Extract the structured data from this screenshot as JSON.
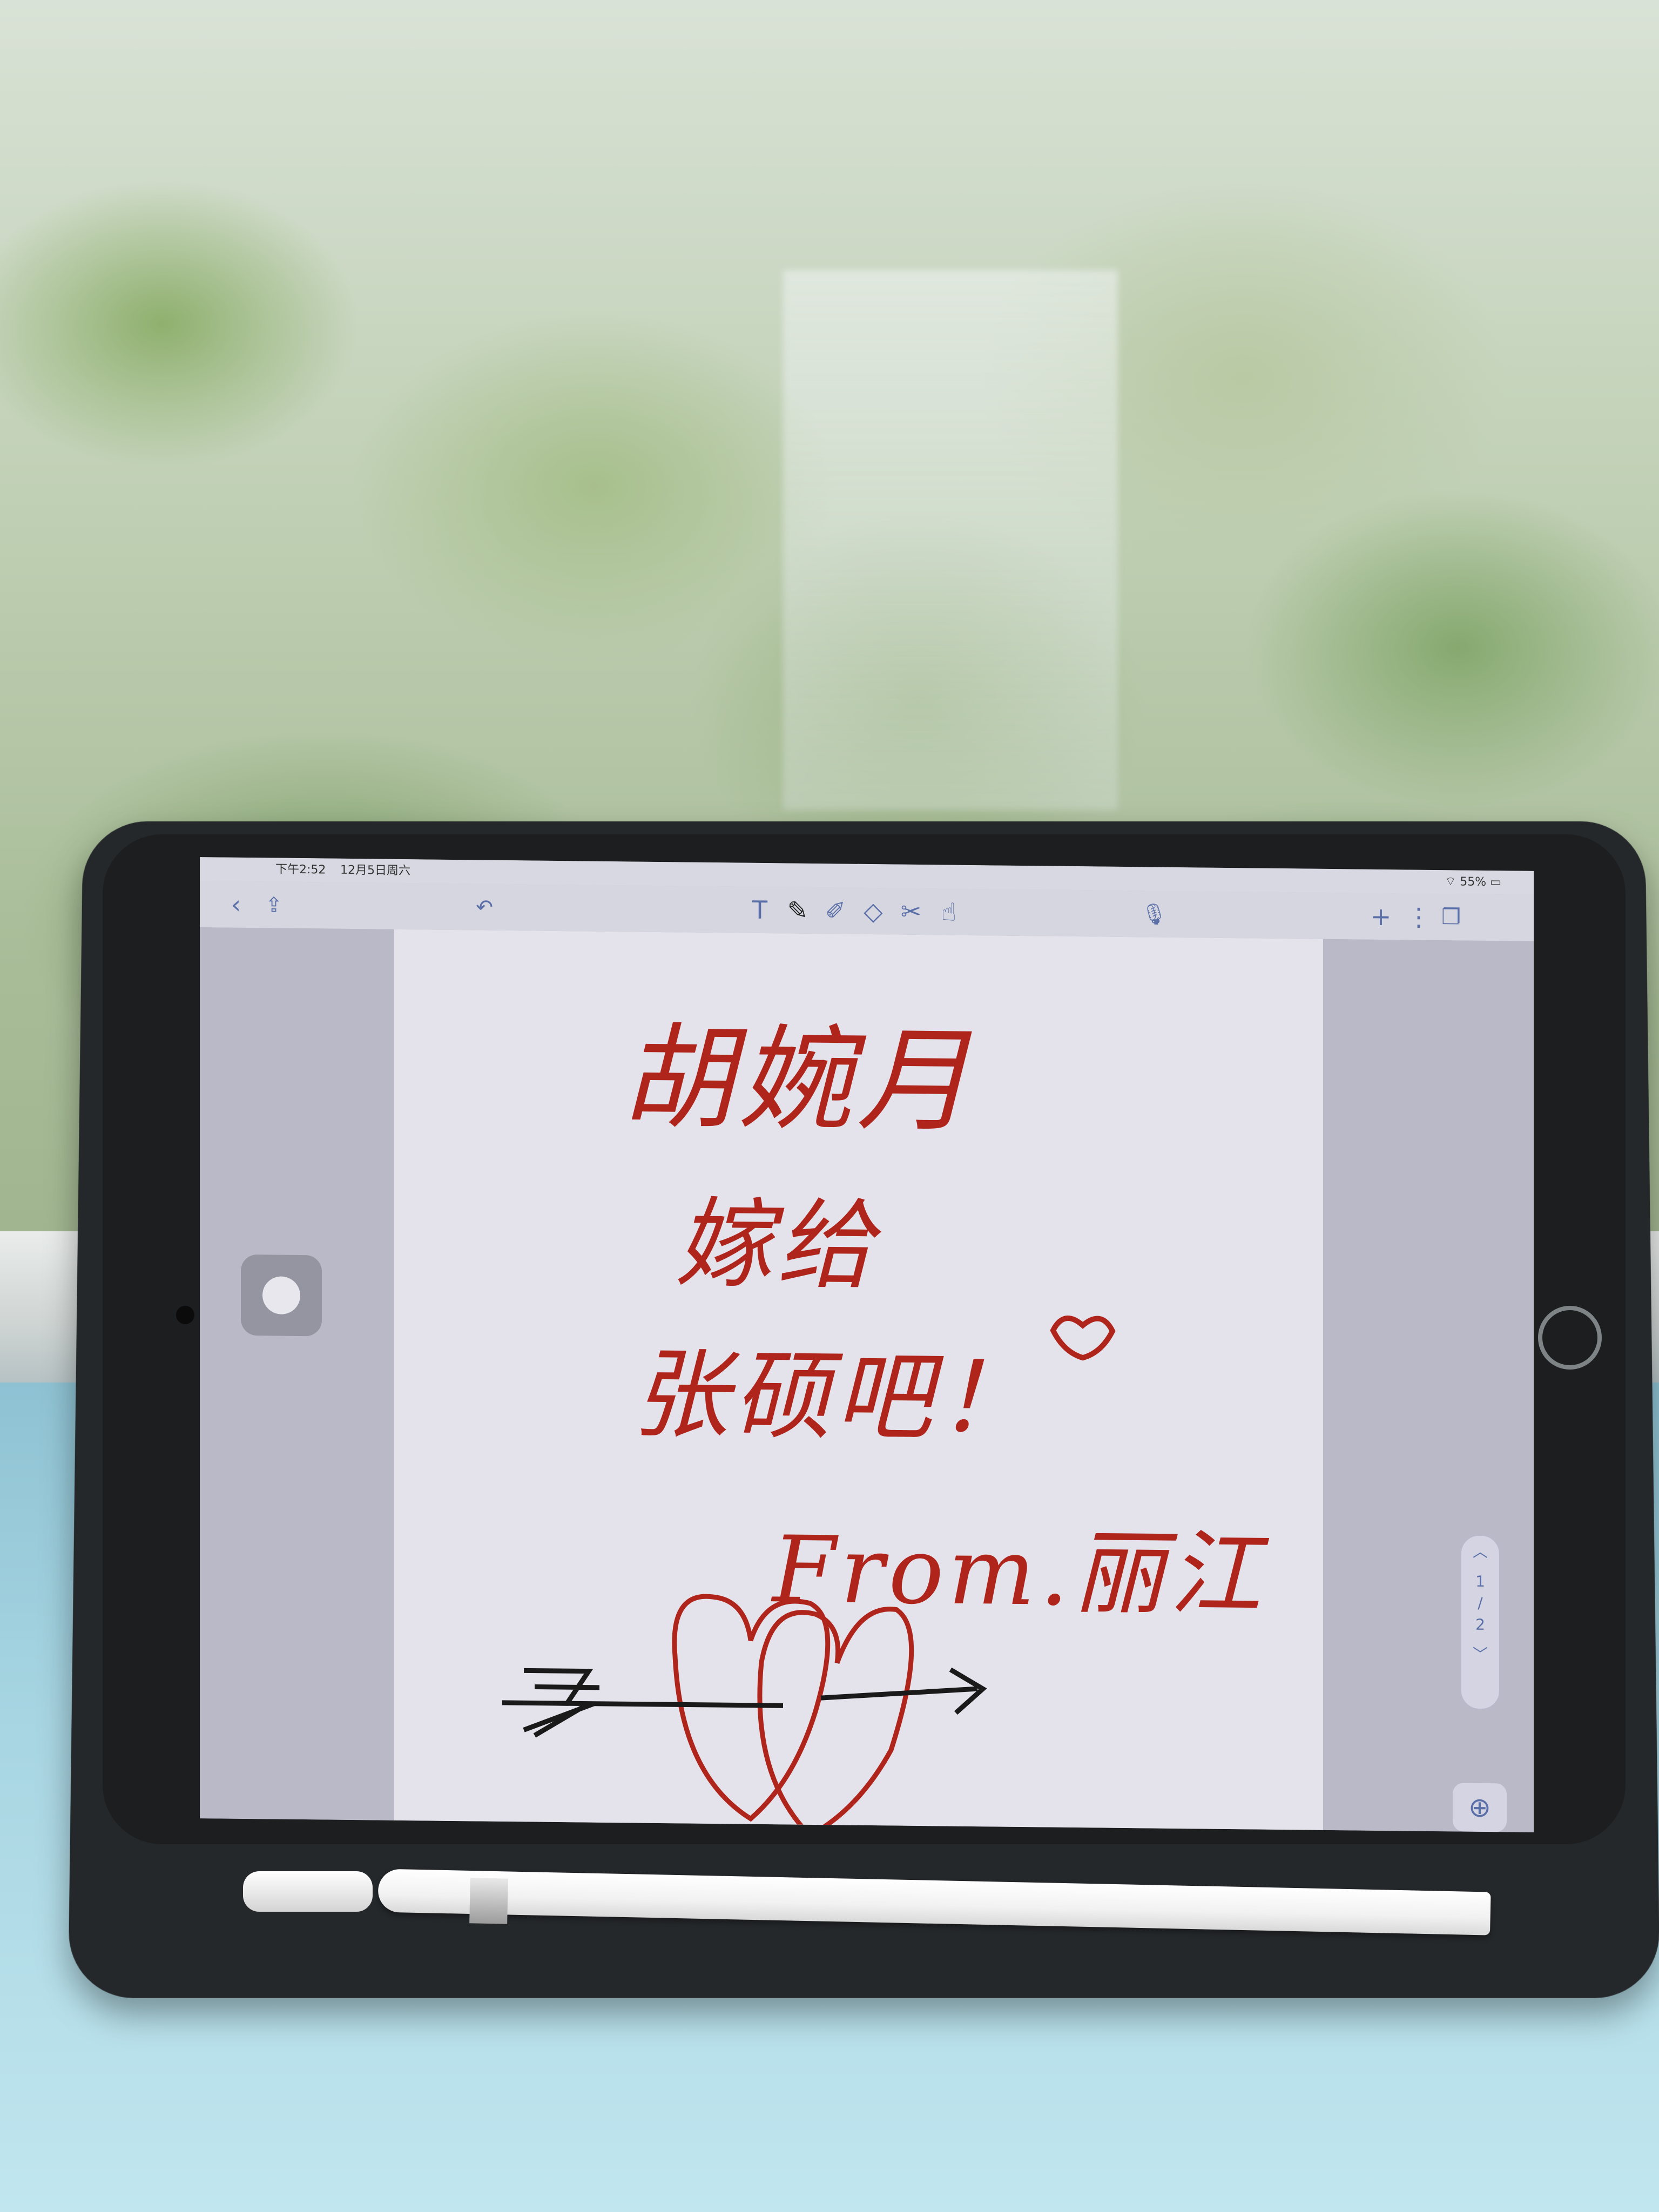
{
  "status_bar": {
    "time": "下午2:52",
    "date": "12月5日周六",
    "battery": "55%"
  },
  "toolbar": {
    "back_icon": "chevron-left-icon",
    "share_icon": "share-icon",
    "undo_icon": "undo-icon",
    "tools": [
      "text-tool-icon",
      "pen-tool-icon",
      "highlighter-tool-icon",
      "eraser-tool-icon",
      "scissors-tool-icon",
      "hand-tool-icon"
    ],
    "mic_icon": "microphone-icon",
    "add_icon": "plus-icon",
    "more_icon": "more-icon",
    "pages_icon": "pages-icon"
  },
  "page_nav": {
    "current": "1",
    "separator": "/",
    "total": "2"
  },
  "handwriting": {
    "line1": "胡婉月",
    "line2": "嫁给",
    "line3": "张硕吧！",
    "line4": "From.丽江"
  },
  "colors": {
    "ink_red": "#b0251b",
    "ink_black": "#1a1a1a",
    "toolbar_icon": "#5a6fa8"
  }
}
